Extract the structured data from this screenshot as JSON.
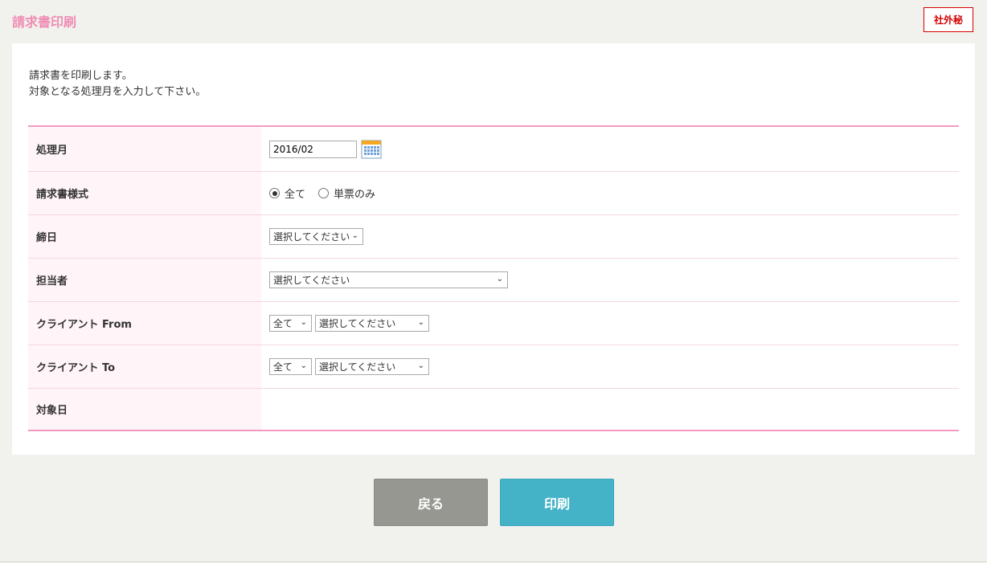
{
  "page": {
    "title": "請求書印刷",
    "confidential_label": "社外秘"
  },
  "intro": {
    "line1": "請求書を印刷します。",
    "line2": "対象となる処理月を入力して下さい。"
  },
  "form": {
    "rows": [
      {
        "label": "処理月",
        "input_value": "2016/02"
      },
      {
        "label": "請求書様式",
        "options": [
          "全て",
          "単票のみ"
        ],
        "selected": "全て"
      },
      {
        "label": "締日",
        "select_value": "選択してください"
      },
      {
        "label": "担当者",
        "select_value": "選択してください"
      },
      {
        "label": "クライアント From",
        "select1_value": "全て",
        "select2_value": "選択してください"
      },
      {
        "label": "クライアント To",
        "select1_value": "全て",
        "select2_value": "選択してください"
      },
      {
        "label": "対象日"
      }
    ]
  },
  "buttons": {
    "back": "戻る",
    "print": "印刷"
  },
  "colors": {
    "title_pink": "#f08cb4",
    "border_pink": "#f39ac0",
    "label_bg": "#fff4f8",
    "confidential_red": "#d40000",
    "back_gray": "#979792",
    "print_teal": "#44b3c8"
  },
  "icons": {
    "calendar": "calendar-icon",
    "dropdown": "chevron-down-icon"
  }
}
